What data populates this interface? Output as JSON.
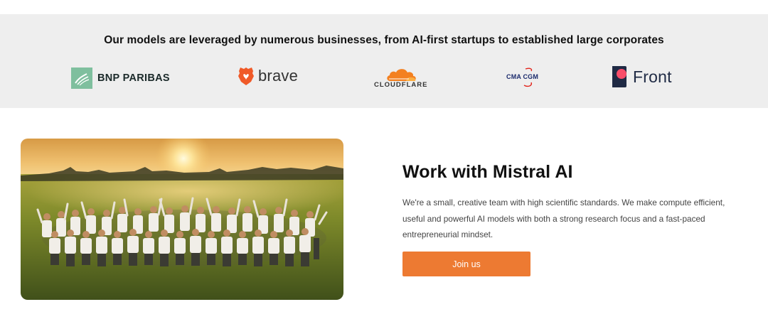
{
  "partners": {
    "title": "Our models are leveraged by numerous businesses, from AI-first startups to established large corporates",
    "logos": [
      {
        "name": "BNP PARIBAS",
        "icon": "bnp-paribas-logo-mark",
        "color": "#7fbf9e"
      },
      {
        "name": "brave",
        "icon": "brave-lion-logo",
        "color": "#f05a28"
      },
      {
        "name": "CLOUDFLARE",
        "icon": "cloudflare-cloud-logo",
        "color": "#f38020"
      },
      {
        "name": "CMA CGM",
        "icon": "cma-cgm-logo",
        "color": "#1a2a6c"
      },
      {
        "name": "Front",
        "icon": "front-logo-mark",
        "color": "#f94d6a"
      }
    ]
  },
  "careers": {
    "heading": "Work with Mistral AI",
    "body": "We're a small, creative team with high scientific standards. We make compute efficient, useful and powerful AI models with both a strong research focus and a fast-paced entrepreneurial mindset.",
    "button_label": "Join us",
    "button_color": "#ed7a32",
    "photo": "team-group-photo-in-field-at-sunset"
  }
}
